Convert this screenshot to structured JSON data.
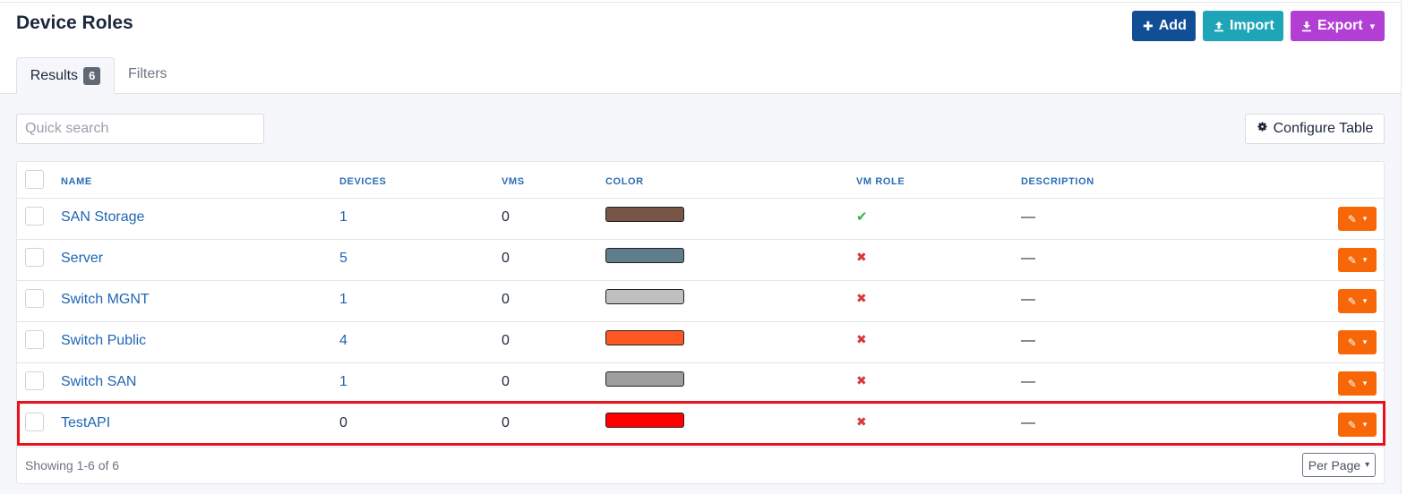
{
  "page": {
    "title": "Device Roles"
  },
  "header_buttons": {
    "add": {
      "label": "Add",
      "icon": "plus-icon"
    },
    "import": {
      "label": "Import",
      "icon": "upload-icon"
    },
    "export": {
      "label": "Export",
      "icon": "download-icon"
    }
  },
  "tabs": {
    "results": {
      "label": "Results",
      "count": "6"
    },
    "filters": {
      "label": "Filters"
    }
  },
  "search": {
    "placeholder": "Quick search",
    "value": ""
  },
  "configure_table": {
    "label": "Configure Table",
    "icon": "gear-icon"
  },
  "table": {
    "columns": {
      "name": "NAME",
      "devices": "DEVICES",
      "vms": "VMS",
      "color": "COLOR",
      "vm_role": "VM ROLE",
      "description": "DESCRIPTION"
    },
    "rows": [
      {
        "name": "SAN Storage",
        "devices": "1",
        "vms": "0",
        "color": "#795548",
        "vm_role": "✔",
        "vm_role_value": true,
        "description": "—"
      },
      {
        "name": "Server",
        "devices": "5",
        "vms": "0",
        "color": "#607d8b",
        "vm_role": "✖",
        "vm_role_value": false,
        "description": "—"
      },
      {
        "name": "Switch MGNT",
        "devices": "1",
        "vms": "0",
        "color": "#c0c0c0",
        "vm_role": "✖",
        "vm_role_value": false,
        "description": "—"
      },
      {
        "name": "Switch Public",
        "devices": "4",
        "vms": "0",
        "color": "#ff5722",
        "vm_role": "✖",
        "vm_role_value": false,
        "description": "—"
      },
      {
        "name": "Switch SAN",
        "devices": "1",
        "vms": "0",
        "color": "#9e9e9e",
        "vm_role": "✖",
        "vm_role_value": false,
        "description": "—"
      },
      {
        "name": "TestAPI",
        "devices": "0",
        "vms": "0",
        "color": "#ff0000",
        "vm_role": "✖",
        "vm_role_value": false,
        "description": "—"
      }
    ]
  },
  "footer": {
    "showing": "Showing 1-6 of 6",
    "per_page_label": "Per Page"
  },
  "colors": {
    "primary": "#104e96",
    "info": "#1ea5b8",
    "export": "#b23ed4",
    "row_action": "#f76707",
    "link": "#1f65b3",
    "check_green": "#2fb344",
    "cross_red": "#d63939",
    "highlight": "#e8121d"
  }
}
